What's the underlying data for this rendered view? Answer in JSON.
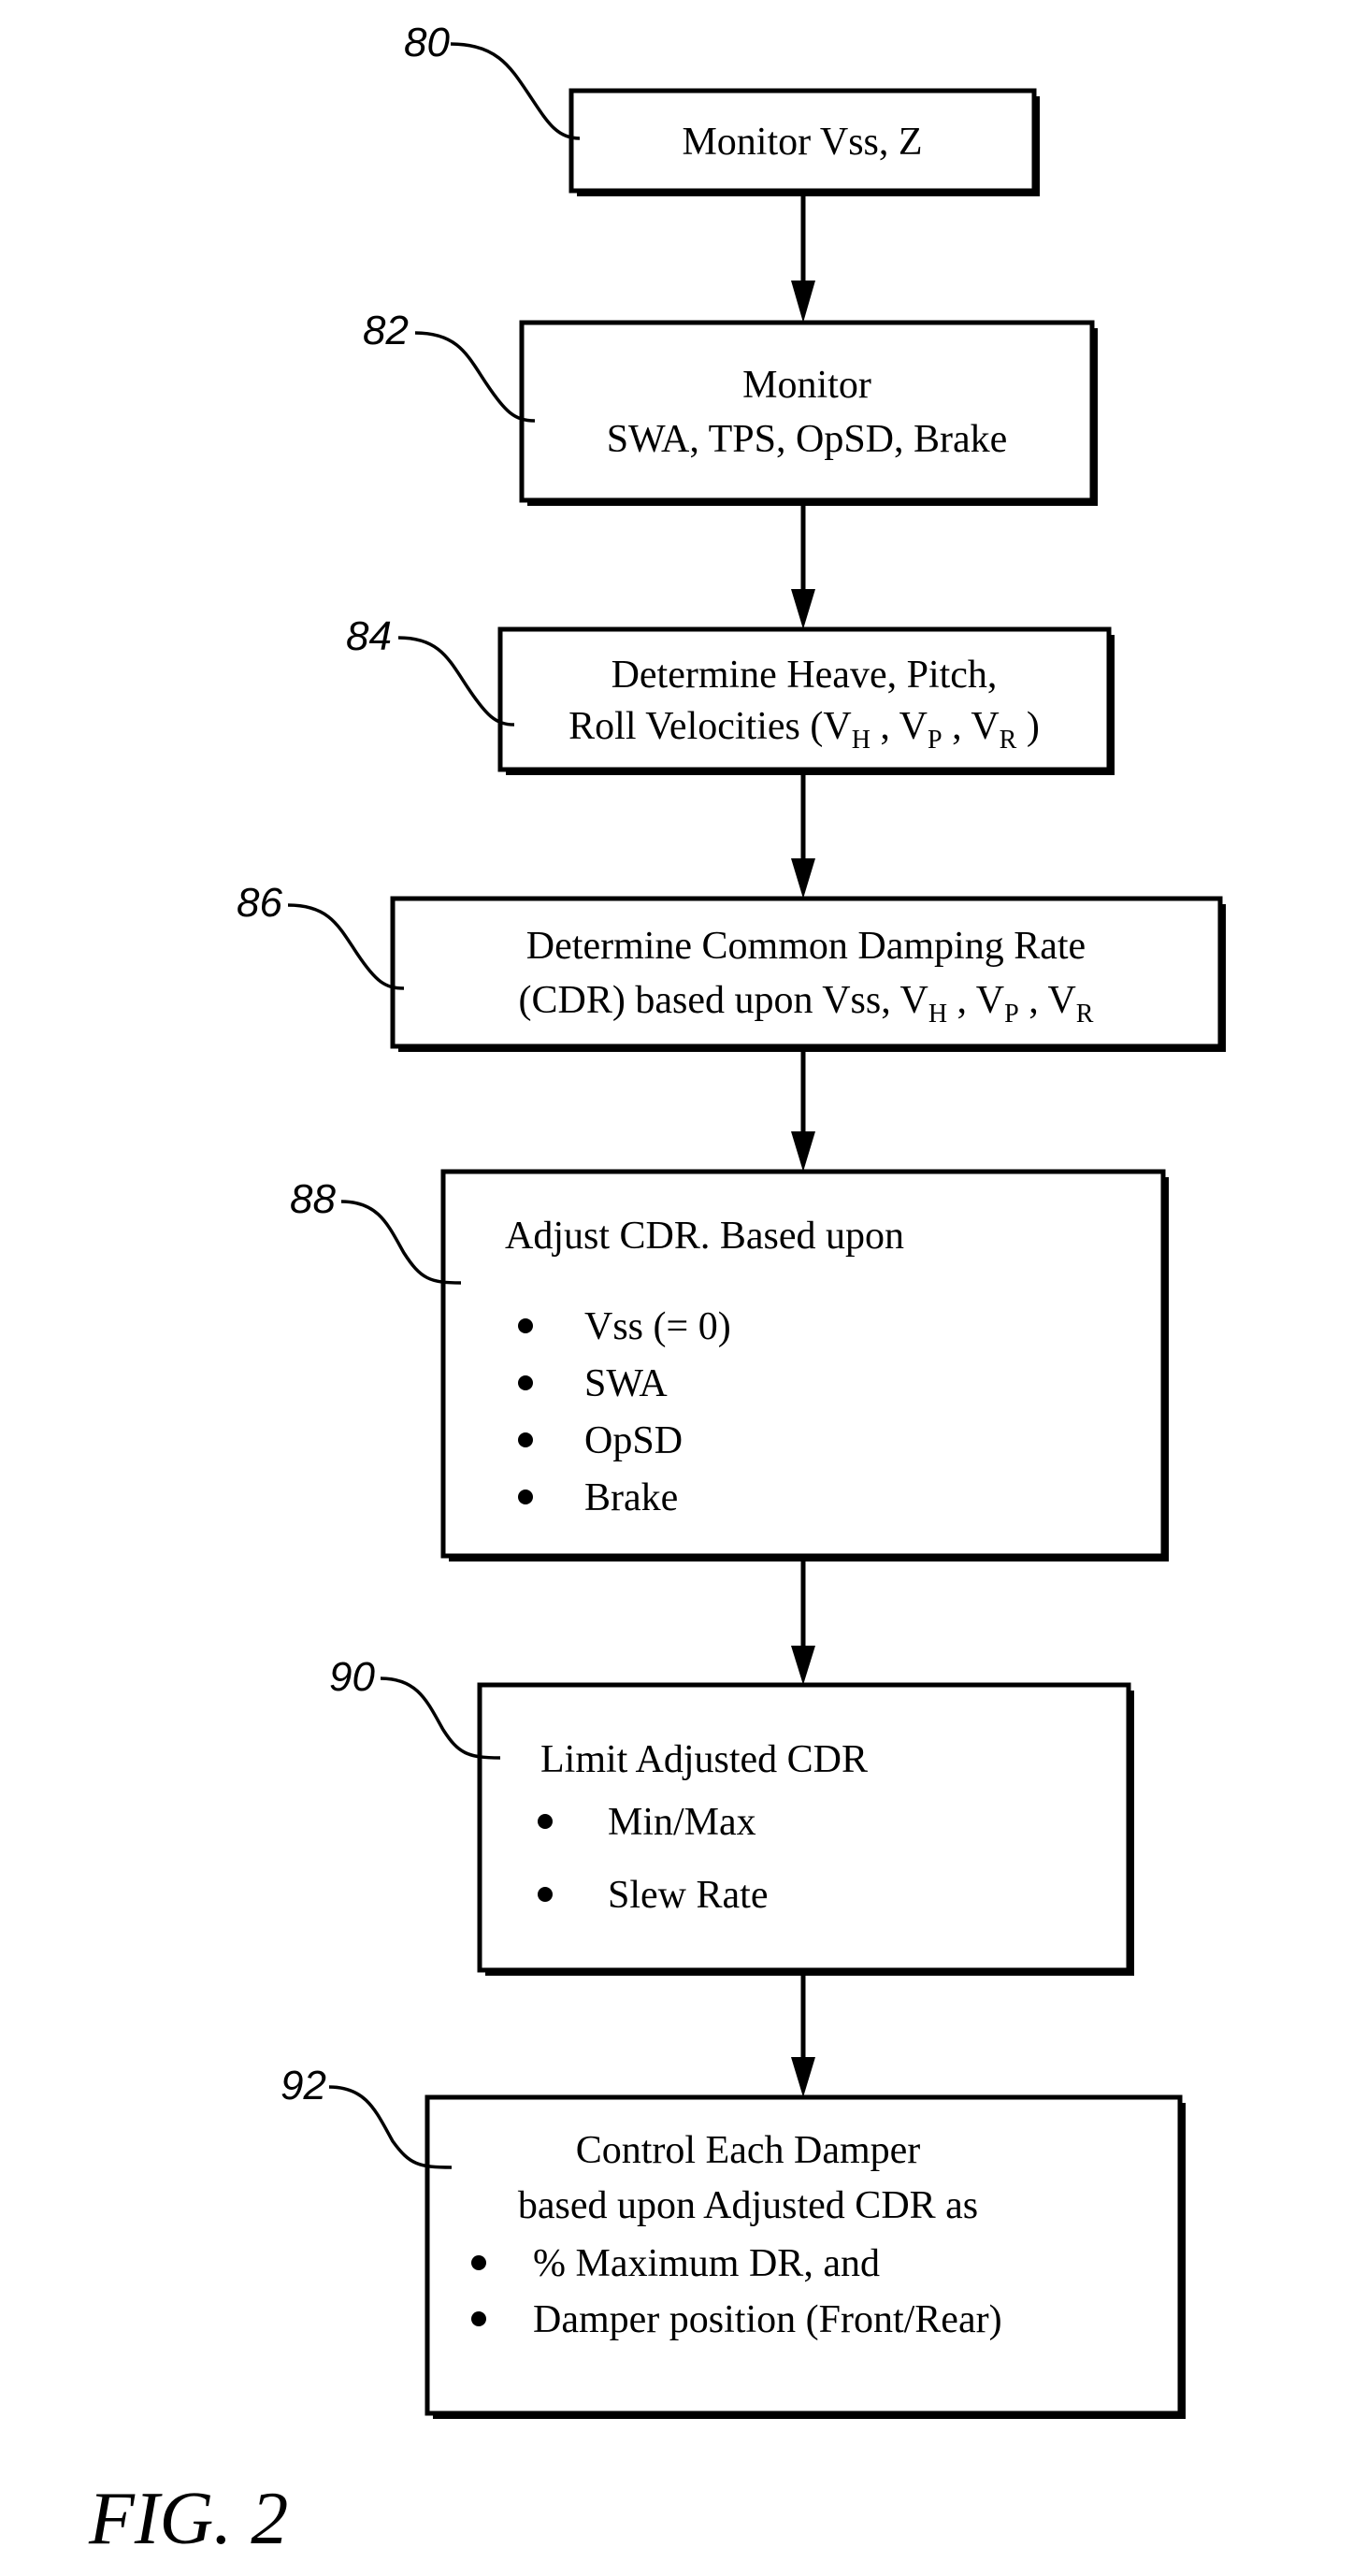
{
  "figure_label": "FIG. 2",
  "steps": [
    {
      "ref": "80",
      "lines": [
        "Monitor Vss, Z"
      ],
      "bullets": []
    },
    {
      "ref": "82",
      "lines": [
        "Monitor",
        "SWA, TPS, OpSD, Brake"
      ],
      "bullets": []
    },
    {
      "ref": "84",
      "lines": [
        "Determine Heave, Pitch,",
        "Roll Velocities (V_H , V_P , V_R )"
      ],
      "bullets": []
    },
    {
      "ref": "86",
      "lines": [
        "Determine Common Damping Rate",
        "(CDR) based upon Vss, V_H , V_P , V_R"
      ],
      "bullets": []
    },
    {
      "ref": "88",
      "lines": [
        "Adjust CDR. Based upon"
      ],
      "bullets": [
        "Vss (= 0)",
        "SWA",
        "OpSD",
        "Brake"
      ]
    },
    {
      "ref": "90",
      "lines": [
        "Limit Adjusted CDR"
      ],
      "bullets": [
        "Min/Max",
        "Slew Rate"
      ]
    },
    {
      "ref": "92",
      "lines": [
        "Control Each Damper",
        "based upon Adjusted CDR as"
      ],
      "bullets": [
        "% Maximum DR, and",
        "Damper position (Front/Rear)"
      ]
    }
  ],
  "text": {
    "s80_l1": "Monitor Vss, Z",
    "s82_l1": "Monitor",
    "s82_l2": "SWA, TPS, OpSD, Brake",
    "s84_l1": "Determine Heave, Pitch,",
    "s84_l2a": "Roll Velocities (V",
    "s84_sub_h": "H",
    "s84_l2b": " , V",
    "s84_sub_p": "P",
    "s84_l2c": " , V",
    "s84_sub_r": "R",
    "s84_l2d": " )",
    "s86_l1": "Determine Common Damping Rate",
    "s86_l2a": "(CDR) based upon Vss, V",
    "s86_sub_h": "H",
    "s86_l2b": " , V",
    "s86_sub_p": "P",
    "s86_l2c": " , V",
    "s86_sub_r": "R",
    "s88_l1": "Adjust CDR. Based upon",
    "s88_b1": "Vss (= 0)",
    "s88_b2": "SWA",
    "s88_b3": "OpSD",
    "s88_b4": "Brake",
    "s90_l1": "Limit Adjusted CDR",
    "s90_b1": "Min/Max",
    "s90_b2": "Slew Rate",
    "s92_l1": "Control Each Damper",
    "s92_l2": "based upon Adjusted CDR as",
    "s92_b1": "% Maximum DR, and",
    "s92_b2": "Damper position (Front/Rear)",
    "ref80": "80",
    "ref82": "82",
    "ref84": "84",
    "ref86": "86",
    "ref88": "88",
    "ref90": "90",
    "ref92": "92"
  }
}
